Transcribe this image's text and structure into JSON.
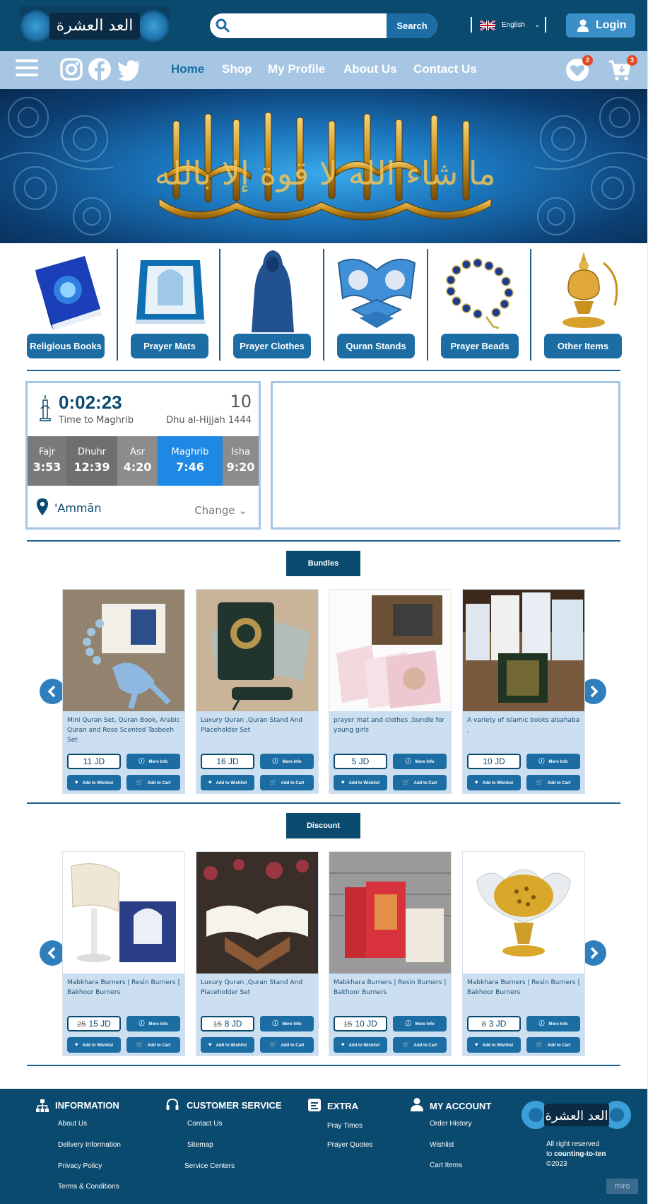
{
  "header": {
    "logo_text": "العد العشرة",
    "search_placeholder": "",
    "search_button": "Search",
    "language": "English",
    "login_label": "Login"
  },
  "nav": {
    "links": [
      {
        "label": "Home",
        "active": true
      },
      {
        "label": "Shop",
        "active": false
      },
      {
        "label": "My Profile",
        "active": false
      },
      {
        "label": "About Us",
        "active": false
      },
      {
        "label": "Contact Us",
        "active": false
      }
    ],
    "wishlist_count": "2",
    "cart_count": "3"
  },
  "hero": {
    "calligraphy_text": "ما شاء الله لا قوة إلا بالله"
  },
  "categories": [
    {
      "label": "Religious Books",
      "icon": "book-icon"
    },
    {
      "label": "Prayer Mats",
      "icon": "prayer-mat-icon"
    },
    {
      "label": "Prayer Clothes",
      "icon": "prayer-clothes-icon"
    },
    {
      "label": "Quran Stands",
      "icon": "quran-stand-icon"
    },
    {
      "label": "Prayer Beads",
      "icon": "prayer-beads-icon"
    },
    {
      "label": "Other Items",
      "icon": "incense-burner-icon"
    }
  ],
  "prayer_widget": {
    "countdown": "0:02:23",
    "countdown_label": "Time to Maghrib",
    "day": "10",
    "hijri_month": "Dhu al-Hijjah 1444",
    "times": [
      {
        "name": "Fajr",
        "time": "3:53"
      },
      {
        "name": "Dhuhr",
        "time": "12:39"
      },
      {
        "name": "Asr",
        "time": "4:20"
      },
      {
        "name": "Maghrib",
        "time": "7:46"
      },
      {
        "name": "Isha",
        "time": "9:20"
      }
    ],
    "active_prayer": "Maghrib",
    "city": "'Ammān",
    "change_label": "Change"
  },
  "bundles": {
    "title": "Bundles",
    "products": [
      {
        "title": "Mini Quran Set, Quran Book, Arabic Quran and Rose Scented Tasbeeh Set",
        "price": "11 JD"
      },
      {
        "title": "Luxury Quran ,Quran Stand And Placeholder Set",
        "price": "16 JD"
      },
      {
        "title": "prayer mat and clothes ,bundle for young girls",
        "price": "5 JD"
      },
      {
        "title": "A variety of islamic books alsahaba ,",
        "price": "10 JD"
      }
    ]
  },
  "discount": {
    "title": "Discount",
    "products": [
      {
        "title": "Mabkhara Burners | Resin Burners | Bakhoor Burners",
        "old_price": "25",
        "price": "15 JD"
      },
      {
        "title": "Luxury Quran ,Quran Stand And Placeholder Set",
        "old_price": "15",
        "price": "8 JD"
      },
      {
        "title": "Mabkhara Burners | Resin Burners | Bakhoor Burners",
        "old_price": "15",
        "price": "10 JD"
      },
      {
        "title": "Mabkhara Burners | Resin Burners | Bakhoor Burners",
        "old_price": "8",
        "price": "3 JD"
      }
    ]
  },
  "buttons": {
    "more_info": "More Info",
    "add_wishlist": "Add to Wishlist",
    "add_cart": "Add to Cart"
  },
  "footer": {
    "information": {
      "title": "INFORMATION",
      "links": [
        "About Us",
        "Delivery Information",
        "Privacy Policy",
        "Terms & Conditions"
      ]
    },
    "customer_service": {
      "title": "CUSTOMER SERVICE",
      "links": [
        "Contact Us",
        "Sitemap",
        "Service Centers"
      ]
    },
    "extra": {
      "title": "EXTRA",
      "links": [
        "Pray Times",
        "Prayer Quotes"
      ]
    },
    "my_account": {
      "title": "MY ACCOUNT",
      "links": [
        "Order History",
        "Wishlist",
        "Cart Items"
      ]
    },
    "rights_line1": "All right reserved",
    "rights_line2": "to",
    "rights_brand": "counting-to-ten",
    "rights_year": "©2023",
    "miro": "miro"
  },
  "colors": {
    "primary_dark": "#0b4a6f",
    "accent": "#1b6da3",
    "nav_bg": "#a7c6e4",
    "card_bg": "#cbdff0",
    "active_prayer": "#1e88e5",
    "badge": "#e24b26"
  }
}
